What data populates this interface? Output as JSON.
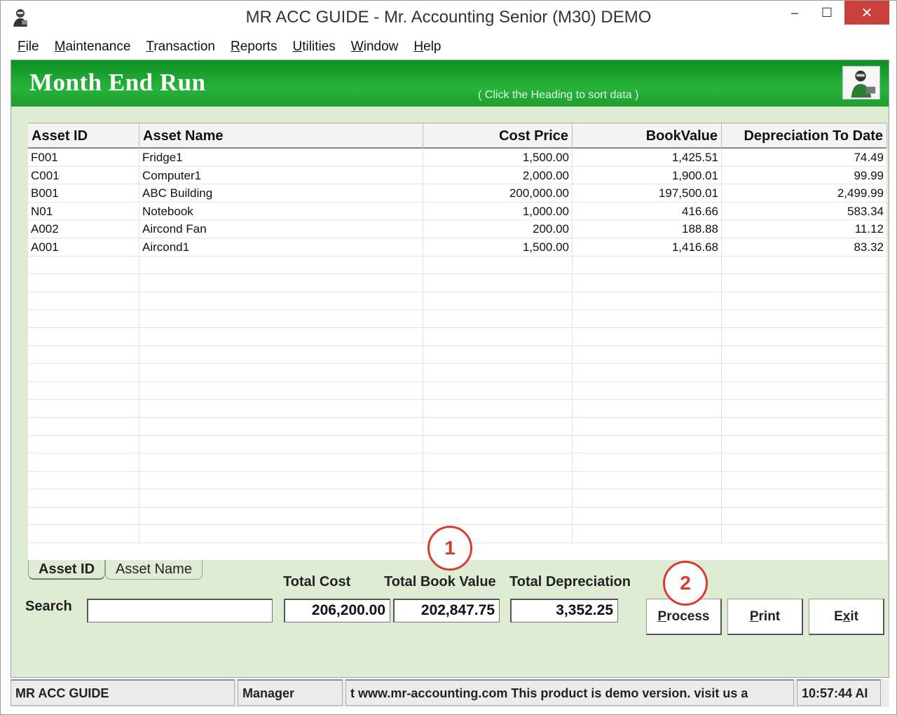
{
  "window": {
    "title": "MR ACC GUIDE - Mr. Accounting Senior (M30) DEMO",
    "controls": {
      "minimize": "–",
      "maximize": "☐",
      "close": "✕"
    }
  },
  "menu": {
    "items": [
      {
        "first": "F",
        "rest": "ile"
      },
      {
        "first": "M",
        "rest": "aintenance"
      },
      {
        "first": "T",
        "rest": "ransaction"
      },
      {
        "first": "R",
        "rest": "eports"
      },
      {
        "first": "U",
        "rest": "tilities"
      },
      {
        "first": "W",
        "rest": "indow"
      },
      {
        "first": "H",
        "rest": "elp"
      }
    ]
  },
  "header": {
    "title": "Month End Run",
    "hint": "( Click the Heading to sort data )"
  },
  "grid": {
    "columns": [
      "Asset ID",
      "Asset Name",
      "Cost Price",
      "BookValue",
      "Depreciation To Date"
    ],
    "rows": [
      [
        "F001",
        "Fridge1",
        "1,500.00",
        "1,425.51",
        "74.49"
      ],
      [
        "C001",
        "Computer1",
        "2,000.00",
        "1,900.01",
        "99.99"
      ],
      [
        "B001",
        "ABC Building",
        "200,000.00",
        "197,500.01",
        "2,499.99"
      ],
      [
        "N01",
        "Notebook",
        "1,000.00",
        "416.66",
        "583.34"
      ],
      [
        "A002",
        "Aircond Fan",
        "200.00",
        "188.88",
        "11.12"
      ],
      [
        "A001",
        "Aircond1",
        "1,500.00",
        "1,416.68",
        "83.32"
      ]
    ]
  },
  "tabs": {
    "active": "Asset ID",
    "other": "Asset Name"
  },
  "totals": {
    "cost_label": "Total Cost",
    "book_label": "Total Book Value",
    "dep_label": "Total Depreciation",
    "cost_value": "206,200.00",
    "book_value": "202,847.75",
    "dep_value": "3,352.25"
  },
  "search": {
    "label": "Search",
    "value": ""
  },
  "buttons": {
    "process": {
      "first": "P",
      "rest": "rocess"
    },
    "print": {
      "first": "P",
      "rest": "rint"
    },
    "exit": {
      "pre": "E",
      "u": "x",
      "rest": "it"
    }
  },
  "callouts": {
    "one": "1",
    "two": "2"
  },
  "statusbar": {
    "app": "MR ACC GUIDE",
    "user": "Manager",
    "message": "t www.mr-accounting.com This product is demo version.  visit us a",
    "time": "10:57:44 AI"
  },
  "colors": {
    "header_green": "#1ea832",
    "panel_bg": "#ddecd2",
    "close_red": "#c9413a",
    "callout_red": "#d93c2f"
  }
}
